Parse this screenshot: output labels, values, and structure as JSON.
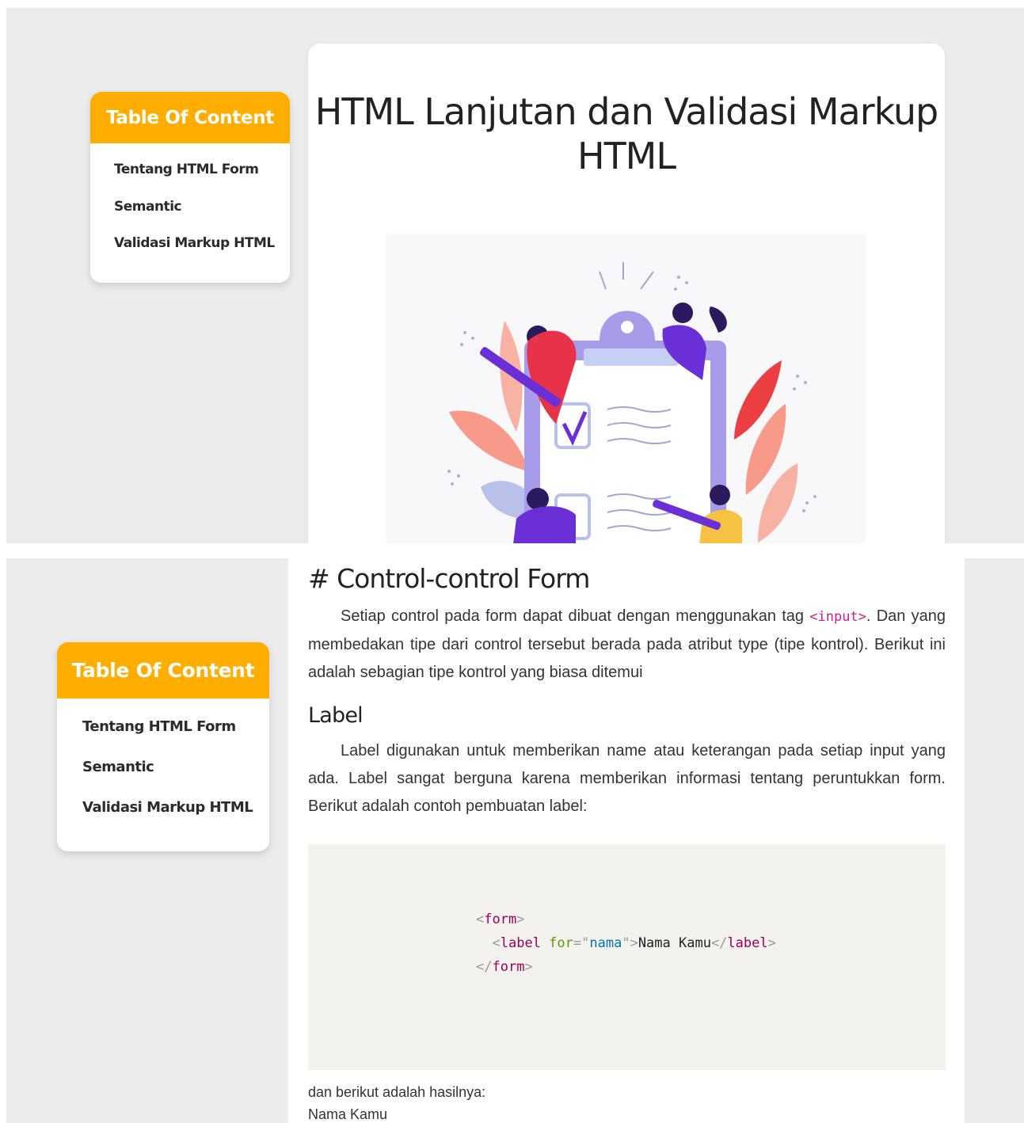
{
  "toc": {
    "heading": "Table Of Content",
    "items": [
      {
        "label": "Tentang HTML Form"
      },
      {
        "label": "Semantic"
      },
      {
        "label": "Validasi Markup HTML"
      }
    ]
  },
  "article": {
    "title": "HTML Lanjutan dan Validasi Markup HTML",
    "section_heading": "# Control-control Form",
    "intro_before_code": "Setiap control pada form dapat dibuat dengan menggunakan tag ",
    "intro_code": "<input>",
    "intro_after_code": ". Dan yang membedakan tipe dari control tersebut berada pada atribut type (tipe kontrol). Berikut ini adalah sebagian tipe kontrol yang biasa ditemui",
    "label_heading": "Label",
    "label_paragraph": "Label digunakan untuk memberikan name atau keterangan pada setiap input yang ada. Label sangat berguna karena memberikan informasi tentang peruntukkan form. Berikut adalah contoh pembuatan label:",
    "code": {
      "form_tag": "form",
      "label_tag": "label",
      "attr_name": "for",
      "attr_value": "nama",
      "label_text": "Nama Kamu"
    },
    "result_caption": "dan berikut adalah hasilnya:",
    "result_label": "Nama Kamu"
  },
  "colors": {
    "accent": "#FFAE00",
    "code_highlight": "#c81e8c",
    "page_background": "#ececec"
  }
}
